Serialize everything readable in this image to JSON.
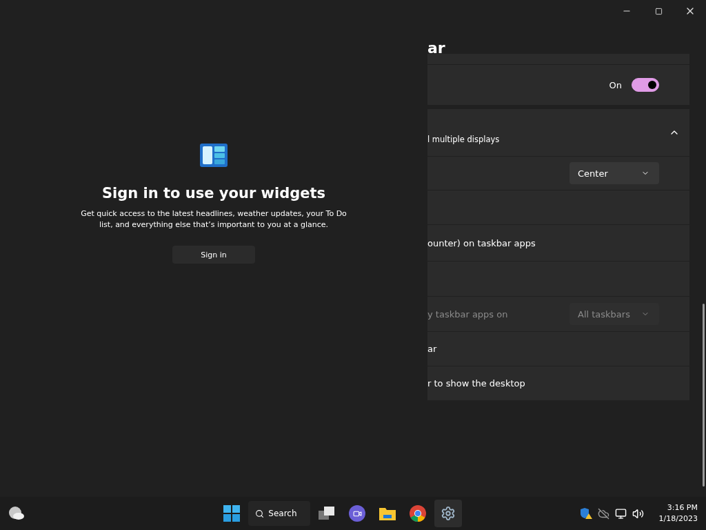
{
  "widgets": {
    "title": "Sign in to use your widgets",
    "description": "Get quick access to the latest headlines, weather updates, your To Do list, and everything else that’s important to you at a glance.",
    "button": "Sign in"
  },
  "settings": {
    "title": "ar",
    "rows": [
      {
        "kind": "top"
      },
      {
        "kind": "toggle",
        "state_label": "On",
        "on": true
      },
      {
        "kind": "expander",
        "label": "l multiple displays",
        "expanded": true
      },
      {
        "kind": "dropdown",
        "value": "Center",
        "disabled": false
      },
      {
        "kind": "blank"
      },
      {
        "kind": "text",
        "label": "ounter) on taskbar apps"
      },
      {
        "kind": "blank"
      },
      {
        "kind": "dropdown",
        "label": "y taskbar apps on",
        "value": "All taskbars",
        "disabled": true
      },
      {
        "kind": "text",
        "label": "ar"
      },
      {
        "kind": "text",
        "label": "r to show the desktop"
      }
    ]
  },
  "taskbar": {
    "search": "Search",
    "time": "3:16 PM",
    "date": "1/18/2023"
  }
}
